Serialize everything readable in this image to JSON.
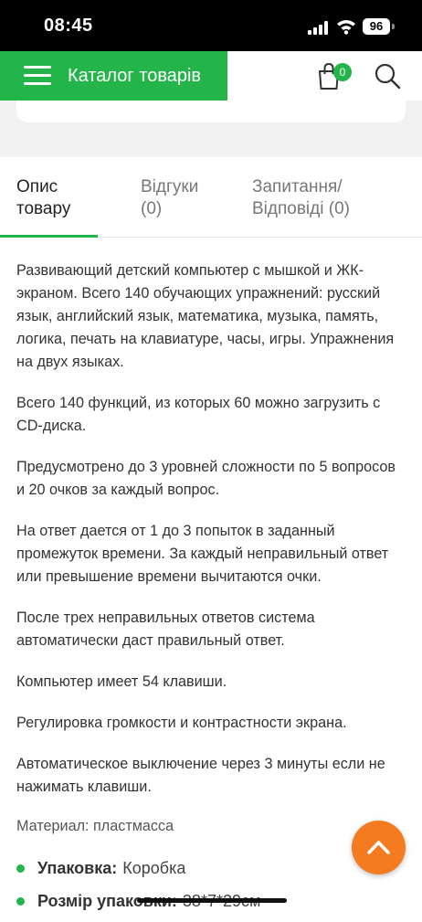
{
  "status_bar": {
    "time": "08:45",
    "battery": "96"
  },
  "header": {
    "catalog_label": "Каталог товарів",
    "cart_count": "0"
  },
  "tabs": [
    {
      "line1": "Опис",
      "line2": "товару"
    },
    {
      "line1": "Відгуки",
      "line2": "(0)"
    },
    {
      "line1": "Запитання/",
      "line2": "Відповіді (0)"
    }
  ],
  "description": [
    "Развивающий детский компьютер с мышкой и ЖК-экраном. Всего 140 обучающих упражнений: русский язык, английский язык, математика, музыка, память, логика, печать на клавиатуре, часы, игры. Упражнения на двух языках.",
    "Всего 140 функций, из которых 60 можно загрузить с CD-диска.",
    "Предусмотрено до 3 уровней сложности по 5 вопросов и 20 очков за каждый вопрос.",
    "На ответ дается от 1 до 3 попыток в заданный промежуток времени. За каждый неправильный ответ или превышение времени вычитаются очки.",
    "После трех неправильных ответов система автоматически даст правильный ответ.",
    "Компьютер имеет 54 клавиши.",
    "Регулировка громкости и контрастности экрана.",
    "Автоматическое выключение через 3 минуты если не нажимать клавиши."
  ],
  "material": "Материал: пластмасса",
  "specs": [
    {
      "key": "Упаковка:",
      "value": "Коробка"
    },
    {
      "key": "Розмір упаковки:",
      "value": "38*7*29см"
    }
  ],
  "colors": {
    "accent_green": "#23b44a",
    "accent_orange": "#f47b20"
  }
}
